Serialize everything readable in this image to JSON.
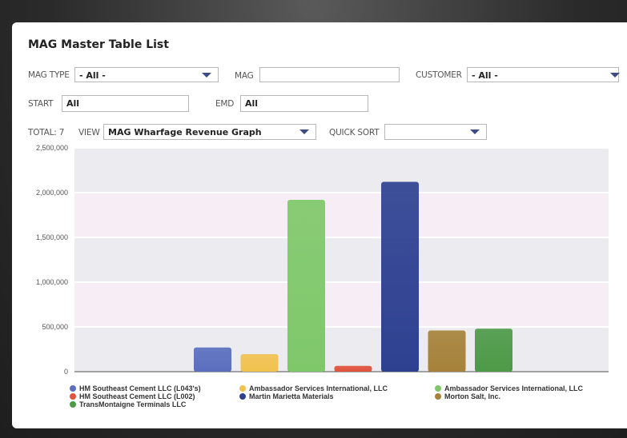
{
  "header": {
    "title": "MAG Master Table List"
  },
  "filters": {
    "mag_type_label": "MAG TYPE",
    "mag_type_value": "- All -",
    "mag_label": "MAG",
    "mag_value": "",
    "customer_label": "CUSTOMER",
    "customer_value": "- All -",
    "start_label": "START",
    "start_value": "All",
    "end_label": "EMD",
    "end_value": "All",
    "total_label": "TOTAL: 7",
    "view_label": "VIEW",
    "view_value": "MAG Wharfage Revenue Graph",
    "quick_sort_label": "QUICK SORT",
    "quick_sort_value": ""
  },
  "chart_data": {
    "type": "bar",
    "ylim": [
      0,
      2500000
    ],
    "yticks": [
      "0",
      "500,000",
      "1,000,000",
      "1,500,000",
      "2,000,000",
      "2,500,000"
    ],
    "grid": true,
    "legend_position": "bottom",
    "series": [
      {
        "name": "HM Southeast Cement LLC (L043's)",
        "value": 270000,
        "color": "#5b6fbf"
      },
      {
        "name": "Ambassador Services International, LLC",
        "value": 195000,
        "color": "#f0c24f"
      },
      {
        "name": "Ambassador Services International, LLC",
        "value": 1920000,
        "color": "#7fc86a"
      },
      {
        "name": "HM Southeast Cement LLC (L002)",
        "value": 65000,
        "color": "#e0533d"
      },
      {
        "name": "Martin Marietta Materials",
        "value": 2120000,
        "color": "#2e4191"
      },
      {
        "name": "Morton Salt, Inc.",
        "value": 460000,
        "color": "#a6823a"
      },
      {
        "name": "TransMontaigne Terminals LLC",
        "value": 480000,
        "color": "#4d9a48"
      }
    ]
  }
}
